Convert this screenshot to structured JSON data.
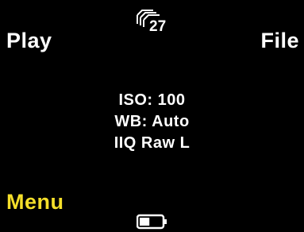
{
  "colors": {
    "background": "#000000",
    "text": "#ffffff",
    "menu_accent": "#f5df2a"
  },
  "softkeys": {
    "top_left": "Play",
    "top_right": "File",
    "bottom_left": "Menu"
  },
  "status": {
    "shots_icon": "stacked-frames-icon",
    "shots_remaining": "27",
    "battery_icon": "battery-icon",
    "battery_level": 0.45
  },
  "settings": {
    "iso": "ISO: 100",
    "wb": "WB: Auto",
    "format": "IIQ Raw L"
  }
}
